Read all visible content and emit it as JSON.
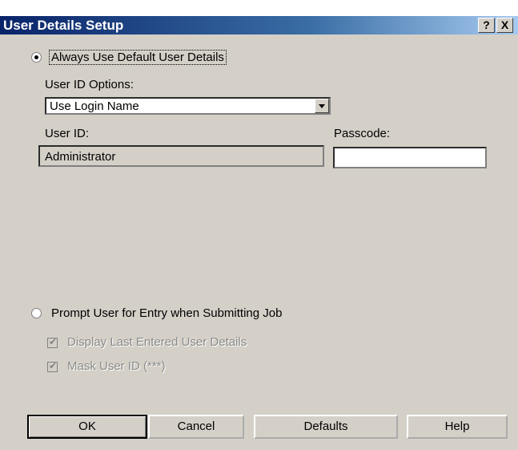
{
  "window": {
    "title": "User Details Setup",
    "help_glyph": "?",
    "close_glyph": "X"
  },
  "options": {
    "always_default_label": "Always Use Default User Details",
    "always_default_selected": true,
    "prompt_label": "Prompt User for Entry when Submitting Job",
    "prompt_selected": false
  },
  "user_id_options": {
    "label": "User ID Options:",
    "selected": "Use Login Name"
  },
  "user_id": {
    "label": "User ID:",
    "value": "Administrator"
  },
  "passcode": {
    "label": "Passcode:",
    "value": ""
  },
  "checkboxes": {
    "display_last": {
      "label": "Display Last Entered User Details",
      "checked": true,
      "enabled": false
    },
    "mask_user_id": {
      "label": "Mask User ID (***)",
      "checked": true,
      "enabled": false
    }
  },
  "buttons": {
    "ok": "OK",
    "cancel": "Cancel",
    "defaults": "Defaults",
    "help": "Help"
  },
  "colors": {
    "titlebar_start": "#0a246a",
    "titlebar_end": "#a6caf0",
    "dialog_bg": "#d4d0c8"
  }
}
